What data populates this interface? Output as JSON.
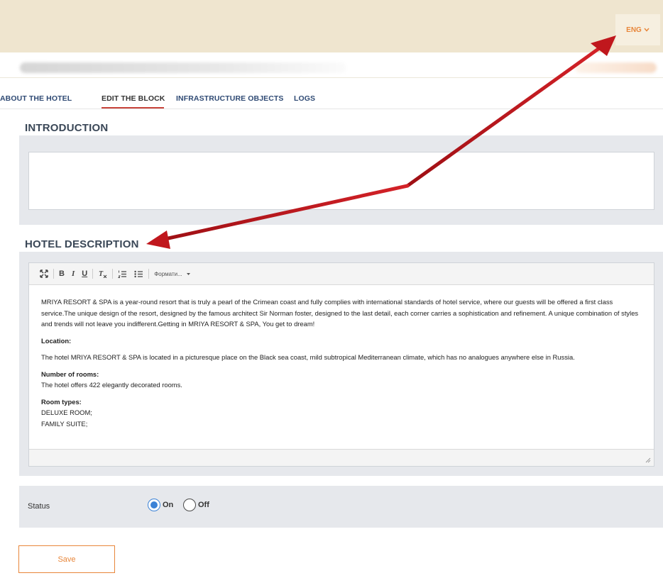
{
  "header": {
    "language": "ENG",
    "accent_color": "#e8863a",
    "background": "#efe5cf"
  },
  "tabs": [
    {
      "label": "ABOUT THE HOTEL",
      "active": false
    },
    {
      "label": "EDIT THE BLOCK",
      "active": true
    },
    {
      "label": "INFRASTRUCTURE OBJECTS",
      "active": false
    },
    {
      "label": "LOGS",
      "active": false
    }
  ],
  "introduction": {
    "title": "INTRODUCTION",
    "value": ""
  },
  "hotel_description": {
    "title": "HOTEL DESCRIPTION",
    "toolbar": {
      "bold": "B",
      "italic": "I",
      "underline": "U",
      "format_label": "Формати...",
      "icons": [
        "fullscreen-icon",
        "clear-format-icon",
        "ordered-list-icon",
        "bullet-list-icon",
        "chevron-down-icon"
      ]
    },
    "content": {
      "intro": "MRIYA RESORT & SPA is a year-round resort that is truly a pearl of the Crimean coast and fully complies with international standards of hotel service, where our guests will be offered a first class service.The unique design of the resort, designed by the famous architect Sir Norman foster, designed to the last detail, each corner carries a sophistication and refinement. A unique combination of styles and trends will not leave you indifferent.Getting in MRIYA RESORT & SPA, You get to dream!",
      "location_heading": "Location:",
      "location_text": "The hotel MRIYA RESORT & SPA is located in a picturesque place on the Black sea coast, mild subtropical Mediterranean climate, which has no analogues anywhere else in Russia.",
      "rooms_heading": "Number of rooms:",
      "rooms_text": "The hotel offers 422 elegantly decorated rooms.",
      "types_heading": "Room types:",
      "type_1": "DELUXE ROOM;",
      "type_2": "FAMILY SUITE;"
    }
  },
  "status": {
    "label": "Status",
    "on_label": "On",
    "off_label": "Off",
    "selected": "On",
    "radio_color": "#3b82d6"
  },
  "actions": {
    "save_label": "Save"
  },
  "annotation": {
    "arrow_color": "#c0171d"
  }
}
